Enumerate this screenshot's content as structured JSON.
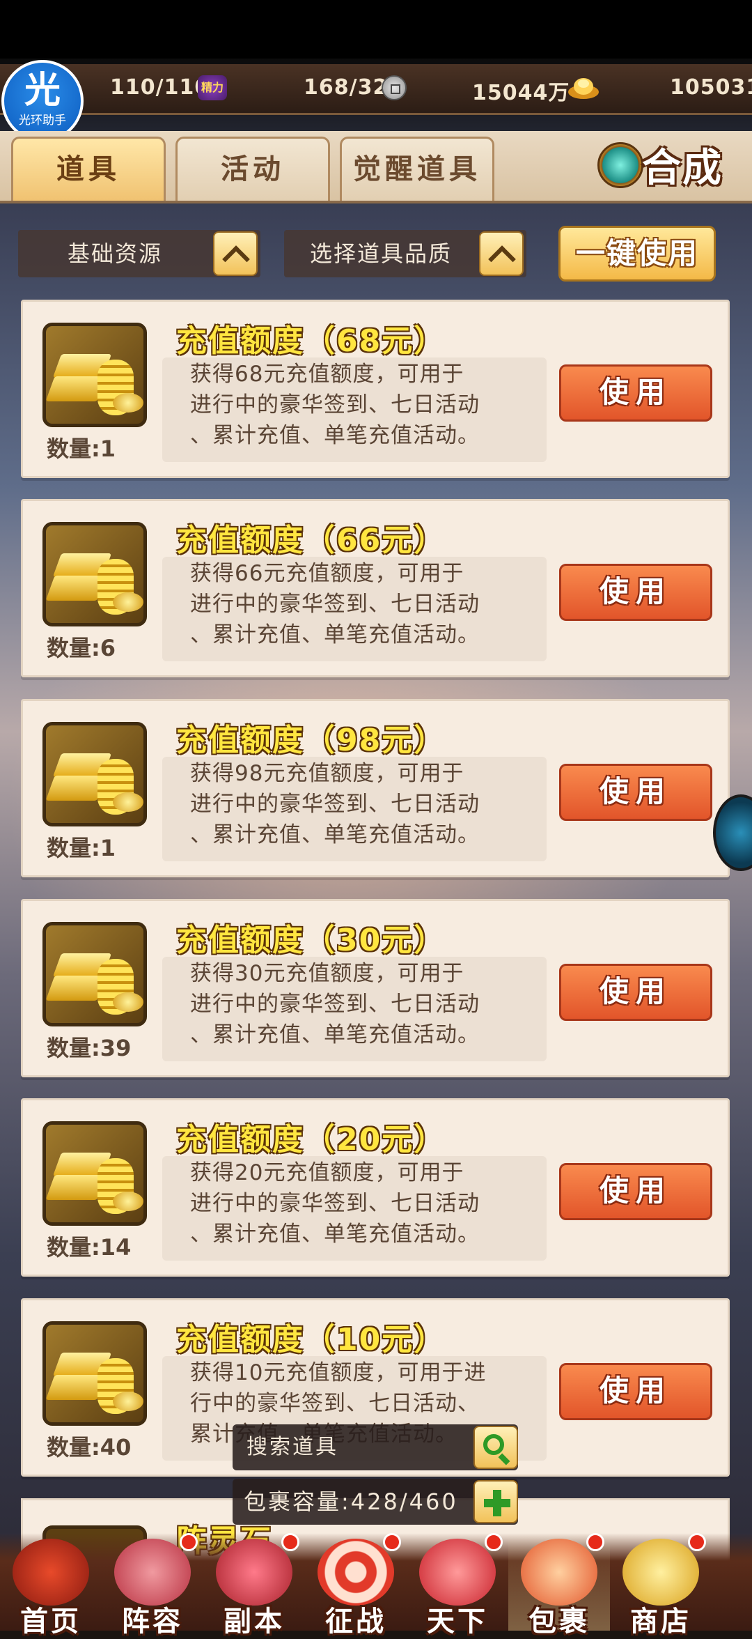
{
  "header": {
    "logo": {
      "big": "光",
      "small": "光环助手"
    },
    "stamina": "110/110",
    "stamina_icon": "精力",
    "coins_ratio": "168/32",
    "silver": "15044万",
    "gold": "105031"
  },
  "tabs": [
    {
      "label": "道具",
      "active": true
    },
    {
      "label": "活动",
      "active": false
    },
    {
      "label": "觉醒道具",
      "active": false
    }
  ],
  "hecheng_label": "合成",
  "filters": {
    "category": "基础资源",
    "quality": "选择道具品质",
    "one_click_use": "一键使用"
  },
  "items": [
    {
      "title": "充值额度（68元）",
      "qty": "数量:1",
      "desc": "获得68元充值额度，可用于\n进行中的豪华签到、七日活动\n、累计充值、单笔充值活动。",
      "use": "使用"
    },
    {
      "title": "充值额度（66元）",
      "qty": "数量:6",
      "desc": "获得66元充值额度，可用于\n进行中的豪华签到、七日活动\n、累计充值、单笔充值活动。",
      "use": "使用"
    },
    {
      "title": "充值额度（98元）",
      "qty": "数量:1",
      "desc": "获得98元充值额度，可用于\n进行中的豪华签到、七日活动\n、累计充值、单笔充值活动。",
      "use": "使用"
    },
    {
      "title": "充值额度（30元）",
      "qty": "数量:39",
      "desc": "获得30元充值额度，可用于\n进行中的豪华签到、七日活动\n、累计充值、单笔充值活动。",
      "use": "使用"
    },
    {
      "title": "充值额度（20元）",
      "qty": "数量:14",
      "desc": "获得20元充值额度，可用于\n进行中的豪华签到、七日活动\n、累计充值、单笔充值活动。",
      "use": "使用"
    },
    {
      "title": "充值额度（10元）",
      "qty": "数量:40",
      "desc": "获得10元充值额度，可用于进\n行中的豪华签到、七日活动、\n累计充值、单笔充值活动。",
      "use": "使用"
    }
  ],
  "partial_item_title": "阵灵石",
  "search": {
    "label": "搜索道具"
  },
  "capacity": {
    "label": "包裹容量:428/460"
  },
  "nav": [
    {
      "label": "首页",
      "badge": false,
      "active": false
    },
    {
      "label": "阵容",
      "badge": true,
      "active": false
    },
    {
      "label": "副本",
      "badge": true,
      "active": false
    },
    {
      "label": "征战",
      "badge": true,
      "active": false
    },
    {
      "label": "天下",
      "badge": true,
      "active": false
    },
    {
      "label": "包裹",
      "badge": true,
      "active": true
    },
    {
      "label": "商店",
      "badge": true,
      "active": false
    }
  ],
  "colors": {
    "accent_gold": "#ffe640",
    "use_button": "#e2552a",
    "card_bg": "#f7ece0"
  }
}
